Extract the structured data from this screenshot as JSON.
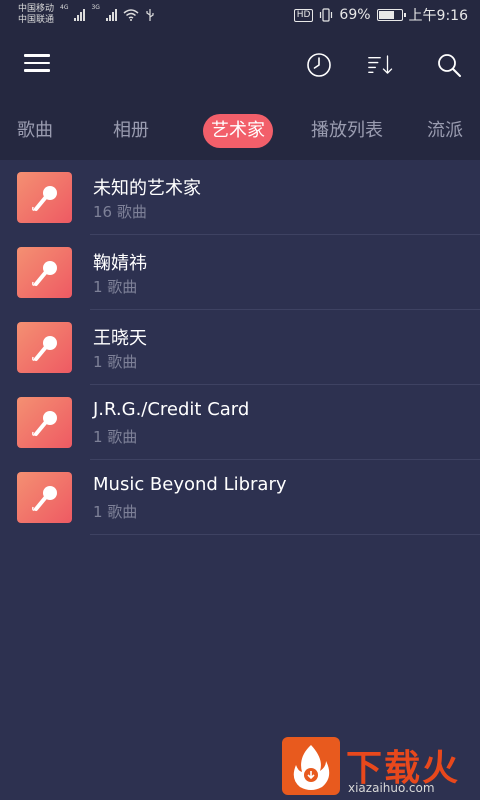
{
  "status_bar": {
    "carrier_1": "中国移动",
    "carrier_2": "中国联通",
    "signal_1_label": "4G",
    "signal_2_label": "3G",
    "hd_label": "HD",
    "battery_percent": "69%",
    "battery_level": 0.69,
    "time": "上午9:16"
  },
  "toolbar": {
    "menu_icon": "hamburger-menu-icon",
    "history_icon": "clock-icon",
    "sort_icon": "sort-icon",
    "search_icon": "search-icon"
  },
  "tabs": [
    {
      "label": "歌曲",
      "active": false
    },
    {
      "label": "相册",
      "active": false
    },
    {
      "label": "艺术家",
      "active": true
    },
    {
      "label": "播放列表",
      "active": false
    },
    {
      "label": "流派",
      "active": false
    }
  ],
  "artists": [
    {
      "name": "未知的艺术家",
      "count": "16 歌曲"
    },
    {
      "name": "鞠婧祎",
      "count": "1 歌曲"
    },
    {
      "name": "王晓天",
      "count": "1 歌曲"
    },
    {
      "name": "J.R.G./Credit Card",
      "count": "1 歌曲"
    },
    {
      "name": "Music Beyond Library",
      "count": "1 歌曲"
    }
  ],
  "watermark": {
    "text": "下载火",
    "url": "xiazaihuo.com"
  },
  "colors": {
    "background": "#2d3150",
    "header": "#252840",
    "accent": "#f25f6a",
    "avatar_gradient_start": "#f49072",
    "avatar_gradient_end": "#ee5a63",
    "muted_text": "#7e8198"
  }
}
